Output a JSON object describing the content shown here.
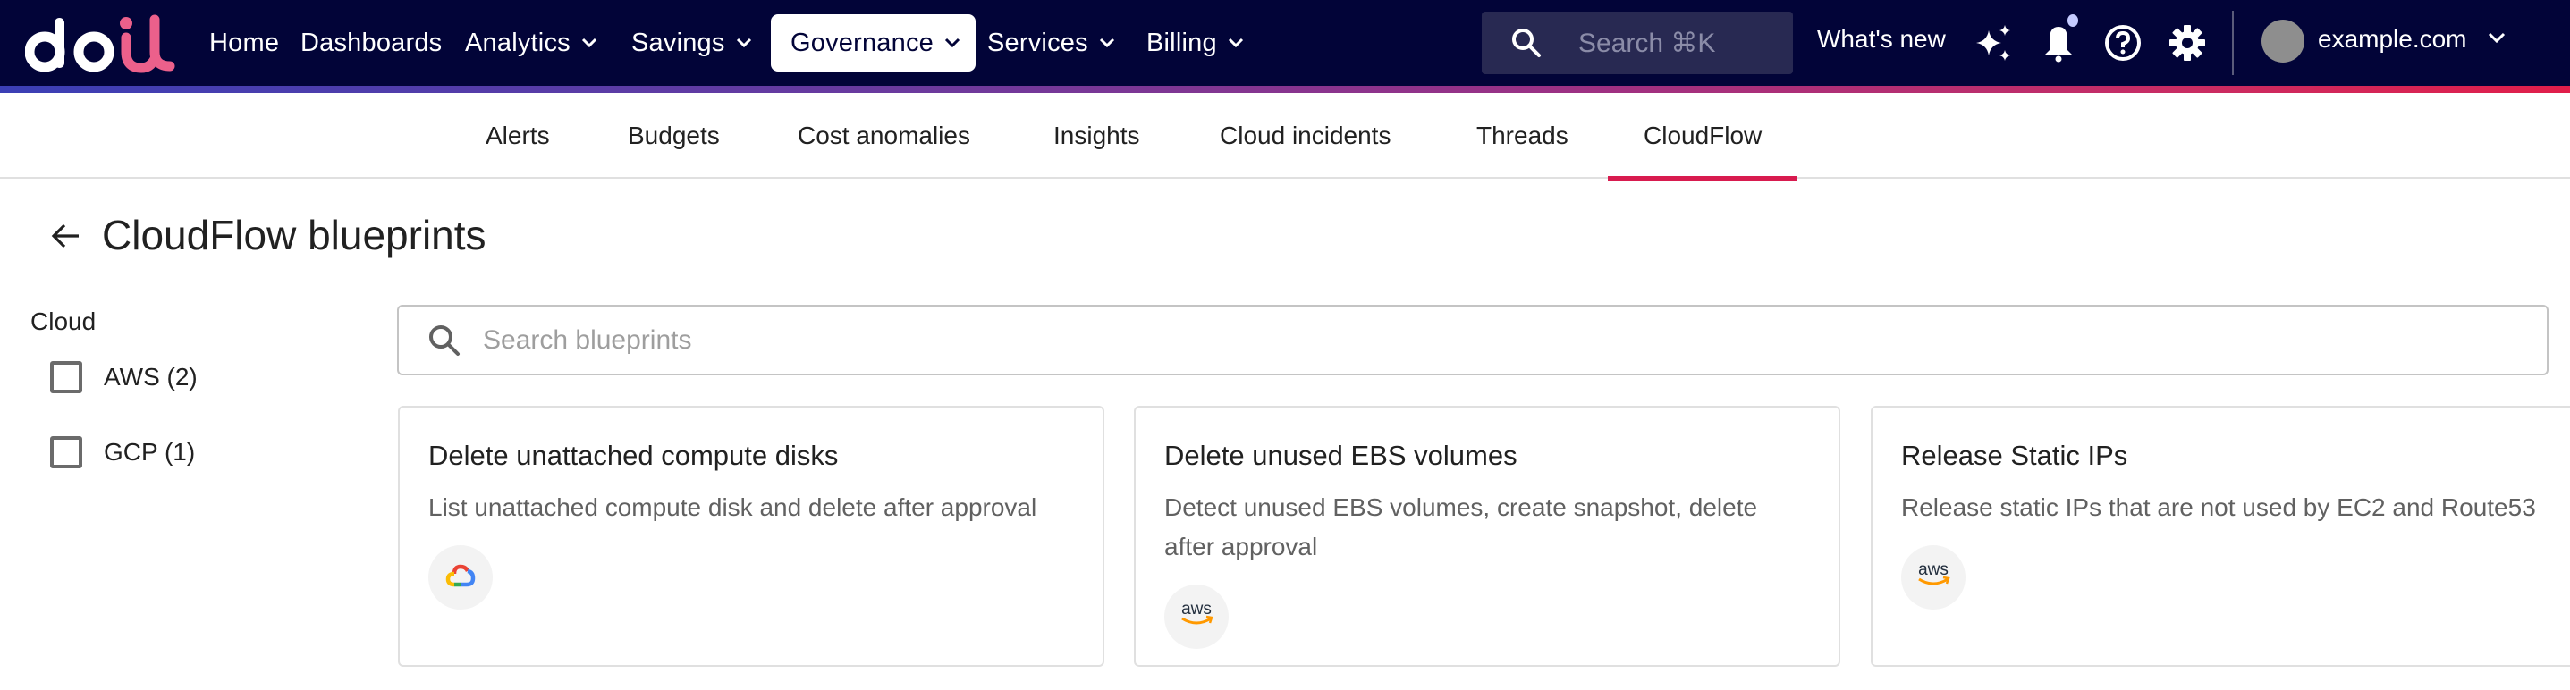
{
  "header": {
    "logo": {
      "part1": "do",
      "part2": "it",
      "colors": {
        "part1": "#ffffff",
        "part2": "#ec608b"
      }
    },
    "nav": [
      {
        "label": "Home",
        "has_dropdown": false,
        "active": false
      },
      {
        "label": "Dashboards",
        "has_dropdown": false,
        "active": false
      },
      {
        "label": "Analytics",
        "has_dropdown": true,
        "active": false
      },
      {
        "label": "Savings",
        "has_dropdown": true,
        "active": false
      },
      {
        "label": "Governance",
        "has_dropdown": true,
        "active": true
      },
      {
        "label": "Services",
        "has_dropdown": true,
        "active": false
      },
      {
        "label": "Billing",
        "has_dropdown": true,
        "active": false
      }
    ],
    "search": {
      "placeholder": "Search ⌘K",
      "icon": "search-icon"
    },
    "whats_new": "What's new",
    "icons": [
      "sparkles-icon",
      "bell-icon",
      "help-icon",
      "gear-icon"
    ],
    "notification_dot": true,
    "account": {
      "name": "example.com",
      "icon": "chevron-down-icon"
    },
    "colors": {
      "background": "#020438",
      "accent": "#d81b4f",
      "search_bg": "#282952"
    }
  },
  "subtabs": {
    "items": [
      {
        "label": "Alerts",
        "active": false
      },
      {
        "label": "Budgets",
        "active": false
      },
      {
        "label": "Cost anomalies",
        "active": false
      },
      {
        "label": "Insights",
        "active": false
      },
      {
        "label": "Cloud incidents",
        "active": false
      },
      {
        "label": "Threads",
        "active": false
      },
      {
        "label": "CloudFlow",
        "active": true
      }
    ]
  },
  "page": {
    "title": "CloudFlow blueprints",
    "back_icon": "arrow-left-icon"
  },
  "filters": {
    "title": "Cloud",
    "options": [
      {
        "label": "AWS (2)",
        "checked": false
      },
      {
        "label": "GCP (1)",
        "checked": false
      }
    ]
  },
  "search": {
    "placeholder": "Search blueprints",
    "value": ""
  },
  "blueprints": [
    {
      "title": "Delete unattached compute disks",
      "description": "List unattached compute disk and delete after approval",
      "provider": "gcp",
      "provider_icon": "google-cloud-icon"
    },
    {
      "title": "Delete unused EBS volumes",
      "description": "Detect unused EBS volumes, create snapshot, delete after approval",
      "provider": "aws",
      "provider_icon": "aws-icon"
    },
    {
      "title": "Release Static IPs",
      "description": "Release static IPs that are not used by EC2 and Route53",
      "provider": "aws",
      "provider_icon": "aws-icon"
    }
  ]
}
